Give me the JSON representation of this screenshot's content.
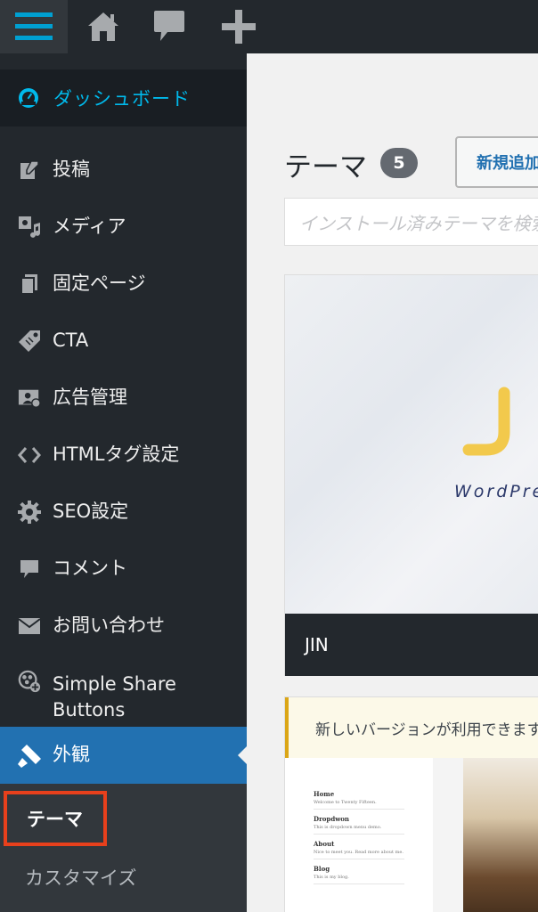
{
  "sidebar": {
    "dashboard": "ダッシュボード",
    "items": [
      {
        "label": "投稿",
        "icon": "pin-icon"
      },
      {
        "label": "メディア",
        "icon": "media-icon"
      },
      {
        "label": "固定ページ",
        "icon": "pages-icon"
      },
      {
        "label": "CTA",
        "icon": "tag-icon"
      },
      {
        "label": "広告管理",
        "icon": "ad-icon"
      },
      {
        "label": "HTMLタグ設定",
        "icon": "code-icon"
      },
      {
        "label": "SEO設定",
        "icon": "gear-icon"
      },
      {
        "label": "コメント",
        "icon": "comment-icon"
      },
      {
        "label": "お問い合わせ",
        "icon": "mail-icon"
      },
      {
        "label": "Simple Share\nButtons",
        "icon": "share-icon"
      }
    ],
    "active": "外観",
    "submenu": {
      "theme": "テーマ",
      "customize": "カスタマイズ"
    }
  },
  "main": {
    "title": "テーマ",
    "count": "5",
    "add_new": "新規追加",
    "search_placeholder": "インストール済みテーマを検索...",
    "active_theme": {
      "name": "JIN",
      "logo_text": "JIN",
      "tagline": "WordPress Theme"
    },
    "notice": "新しいバージョンが利用できます。",
    "preview_menu": [
      {
        "title": "Home",
        "desc": "Welcome to Twenty Fifteen."
      },
      {
        "title": "Dropdwon",
        "desc": "This is dropdown menu demo."
      },
      {
        "title": "About",
        "desc": "Nice to meet you. Read more about me."
      },
      {
        "title": "Blog",
        "desc": "This is my blog."
      }
    ]
  },
  "colors": {
    "sidebar_bg": "#23282d",
    "active_bg": "#2271b1",
    "dashboard_text": "#00b9eb",
    "highlight_border": "#e8401c"
  }
}
